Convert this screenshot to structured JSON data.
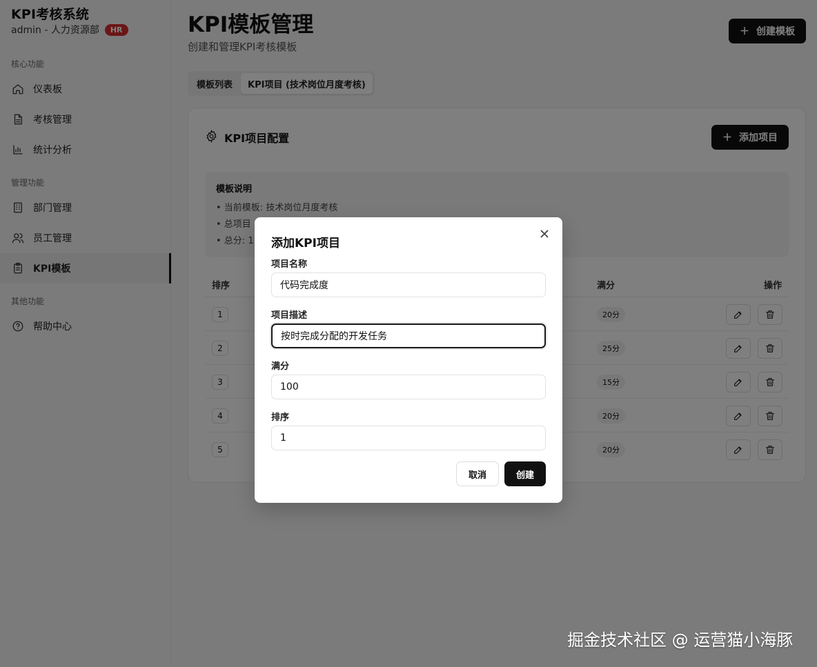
{
  "sidebar": {
    "app_title": "KPI考核系统",
    "user": "admin - 人力资源部",
    "role_badge": "HR",
    "sections": {
      "core": "核心功能",
      "manage": "管理功能",
      "other": "其他功能"
    },
    "items": [
      {
        "label": "仪表板",
        "icon": "home-icon"
      },
      {
        "label": "考核管理",
        "icon": "document-icon"
      },
      {
        "label": "统计分析",
        "icon": "bar-chart-icon"
      },
      {
        "label": "部门管理",
        "icon": "building-icon"
      },
      {
        "label": "员工管理",
        "icon": "users-icon"
      },
      {
        "label": "KPI模板",
        "icon": "clipboard-icon",
        "active": true
      },
      {
        "label": "帮助中心",
        "icon": "help-circle-icon"
      }
    ]
  },
  "header": {
    "title": "KPI模板管理",
    "subtitle": "创建和管理KPI考核模板",
    "create_button": "创建模板"
  },
  "tabs": [
    {
      "label": "模板列表",
      "active": false
    },
    {
      "label": "KPI项目 (技术岗位月度考核)",
      "active": true
    }
  ],
  "card": {
    "title": "KPI项目配置",
    "add_button": "添加项目",
    "info": {
      "title": "模板说明",
      "lines": [
        "• 当前模板: 技术岗位月度考核",
        "• 总项目",
        "• 总分: 1"
      ]
    },
    "table": {
      "headers": {
        "order": "排序",
        "max_score": "满分",
        "actions": "操作"
      },
      "rows": [
        {
          "order": "1",
          "score": "20分"
        },
        {
          "order": "2",
          "score": "25分"
        },
        {
          "order": "3",
          "score": "15分"
        },
        {
          "order": "4",
          "score": "20分"
        },
        {
          "order": "5",
          "score": "20分"
        }
      ]
    }
  },
  "modal": {
    "title": "添加KPI项目",
    "fields": {
      "name": {
        "label": "项目名称",
        "value": "代码完成度"
      },
      "description": {
        "label": "项目描述",
        "value": "按时完成分配的开发任务"
      },
      "max_score": {
        "label": "满分",
        "value": "100"
      },
      "order": {
        "label": "排序",
        "value": "1"
      }
    },
    "cancel": "取消",
    "create": "创建"
  },
  "watermark": "掘金技术社区 @ 运营猫小海豚"
}
